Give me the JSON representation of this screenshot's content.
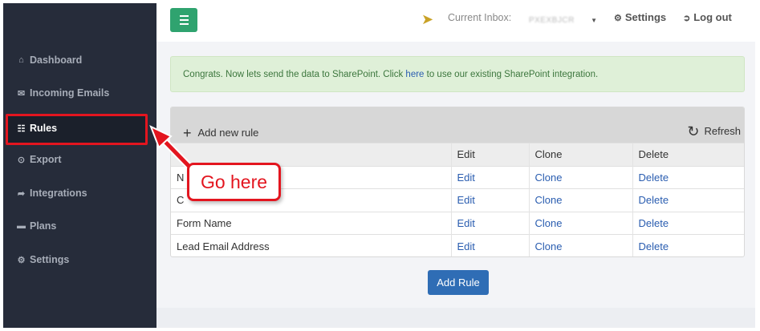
{
  "sidebar": {
    "items": [
      {
        "label": "Dashboard",
        "icon": "home-icon",
        "glyph": "⌂"
      },
      {
        "label": "Incoming Emails",
        "icon": "envelope-icon",
        "glyph": "✉"
      },
      {
        "label": "Rules",
        "icon": "sitemap-icon",
        "glyph": "☷",
        "active": true
      },
      {
        "label": "Export",
        "icon": "circle-dot-icon",
        "glyph": "⊙"
      },
      {
        "label": "Integrations",
        "icon": "share-arrow-icon",
        "glyph": "➦"
      },
      {
        "label": "Plans",
        "icon": "card-icon",
        "glyph": "▬"
      },
      {
        "label": "Settings",
        "icon": "gear-icon",
        "glyph": "⚙"
      }
    ]
  },
  "topbar": {
    "inbox_label": "Current Inbox:",
    "inbox_value": "PXEXBJCR",
    "settings_label": "Settings",
    "logout_label": "Log out"
  },
  "alert": {
    "text_before": "Congrats. Now lets send the data to SharePoint. Click ",
    "link_text": "here",
    "text_after": " to use our existing SharePoint integration."
  },
  "panel": {
    "add_new_label": "Add new rule",
    "refresh_label": "Refresh",
    "columns": [
      "",
      "Edit",
      "Clone",
      "Delete"
    ],
    "rows": [
      {
        "name": "N",
        "edit": "Edit",
        "clone": "Clone",
        "delete": "Delete"
      },
      {
        "name": "C",
        "edit": "Edit",
        "clone": "Clone",
        "delete": "Delete"
      },
      {
        "name": "Form Name",
        "edit": "Edit",
        "clone": "Clone",
        "delete": "Delete"
      },
      {
        "name": "Lead Email Address",
        "edit": "Edit",
        "clone": "Clone",
        "delete": "Delete"
      }
    ]
  },
  "add_rule_label": "Add Rule",
  "callout": {
    "text": "Go here"
  },
  "colors": {
    "sidebar_bg": "#262c3a",
    "accent_green": "#2fa36f",
    "button_blue": "#2f6db5",
    "annotation_red": "#e3151f",
    "alert_bg": "#dff0d8"
  }
}
